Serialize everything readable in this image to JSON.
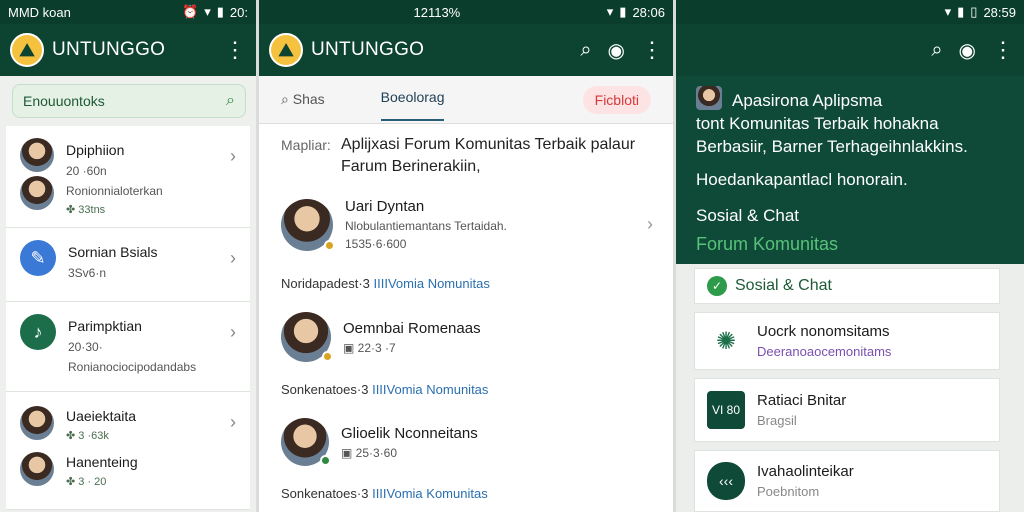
{
  "p1": {
    "status_left": "MMD koan",
    "status_right": "20:",
    "app_title": "UNTUNGGO",
    "search_text": "Enouuontoks",
    "items": [
      {
        "name": "Dpiphiion",
        "stat": "20 ·60n",
        "sub": "Ronionnialoterkan",
        "small": "✤ 33tns"
      },
      {
        "name": "Sornian Bsials",
        "stat": "3Sv6·n",
        "sub": "",
        "small": ""
      },
      {
        "name": "Parimpktian",
        "stat": "20·30·",
        "sub": "Ronianociocipodandabs",
        "small": ""
      },
      {
        "name": "Uaeiektaita",
        "stat": "✤ 3 ·63k",
        "sub": "",
        "small": ""
      },
      {
        "name": "Hanenteing",
        "stat": "✤ 3 · 20",
        "sub": "",
        "small": ""
      }
    ]
  },
  "p2": {
    "status_time": "12113%",
    "status_right": "28:06",
    "app_title": "UNTUNGGO",
    "tabs": {
      "t1": "Shas",
      "t2": "Boeolorag",
      "t3": "Ficbloti"
    },
    "post_label": "Mapliar:",
    "post_title": "Aplijxasi Forum Komunitas Terbaik palaur Farum Berinerakiin,",
    "feed": [
      {
        "name": "Uari Dyntan",
        "desc": "Nlobulantiemantans Tertaidah.",
        "stat": "1535·6·600"
      },
      {
        "name": "Oemnbai Romenaas",
        "desc": "",
        "stat": "22·3 ·7"
      },
      {
        "name": "Glioelik Nconneitans",
        "desc": "",
        "stat": "25·3·60"
      }
    ],
    "foot1_a": "Noridapadest·3 ",
    "foot1_b": "IIIIVomia Nomunitas",
    "foot2_a": "Sonkenatoes·3 ",
    "foot2_b": "IIIIVomia Nomunitas",
    "foot3_a": "Sonkenatoes·3 ",
    "foot3_b": "IIIIVomia Komunitas"
  },
  "p3": {
    "status_right": "28:59",
    "hero": {
      "line1": "Apasirona Aplipsma",
      "line2": "tont Komunitas Terbaik hohakna",
      "line3": "Berbasiir, Barner Terhageihnlakkins.",
      "line4": "Hoedankapantlacl honorain.",
      "category": "Sosial & Chat",
      "sub": "Forum Komunitas"
    },
    "chip": "Sosial & Chat",
    "cards": [
      {
        "title": "Uocrk nonomsitams",
        "sub": "Deeranoaocemonitams",
        "icon_text": "✦"
      },
      {
        "title": "Ratiaci Bnitar",
        "sub": "Bragsil",
        "icon_text": "VI 80"
      },
      {
        "title": "Ivahaolinteikar",
        "sub": "Poebnitom",
        "icon_text": "‹‹‹"
      }
    ]
  },
  "colors": {
    "brand_dark": "#0d4331",
    "accent_green": "#58c27a",
    "link_blue": "#2a6fb0",
    "alert_red": "#d63a3a",
    "logo_yellow": "#f4c23e"
  }
}
